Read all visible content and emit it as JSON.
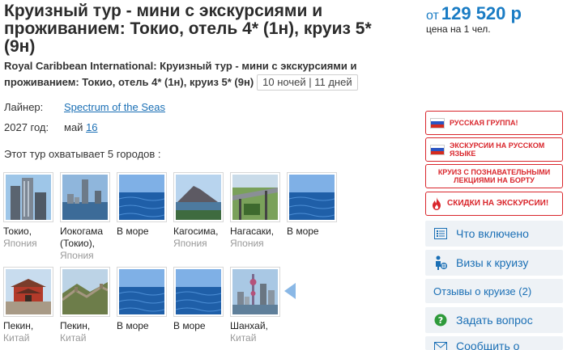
{
  "tour": {
    "title": "Круизный тур - мини с экскурсиями и проживанием: Токио, отель 4* (1н), круиз 5* (9н)",
    "subtitle": "Royal Caribbean International: Круизный тур - мини с экскурсиями и проживанием: Токио, отель 4* (1н), круиз 5* (9н)",
    "duration": "10 ночей | 11 дней"
  },
  "price": {
    "prefix": "от",
    "amount": "129 520 р",
    "note": "цена на 1 чел."
  },
  "liner": {
    "label": "Лайнер:",
    "value": "Spectrum of the Seas"
  },
  "year": {
    "label": "2027 год:",
    "month": "май",
    "day": "16"
  },
  "coverage_text": "Этот тур охватывает 5 городов :",
  "cities": [
    {
      "name": "Токио,",
      "country": "Япония"
    },
    {
      "name": "Иокогама (Токио),",
      "country": "Япония"
    },
    {
      "name": "В море",
      "country": ""
    },
    {
      "name": "Кагосима,",
      "country": "Япония"
    },
    {
      "name": "Нагасаки,",
      "country": "Япония"
    },
    {
      "name": "В море",
      "country": ""
    },
    {
      "name": "Пекин,",
      "country": "Китай"
    },
    {
      "name": "Пекин,",
      "country": "Китай"
    },
    {
      "name": "В море",
      "country": ""
    },
    {
      "name": "В море",
      "country": ""
    },
    {
      "name": "Шанхай,",
      "country": "Китай"
    }
  ],
  "badges": {
    "russian_group": "Русская группа!",
    "excursions_russian": "Экскурсии на русском языке",
    "lectures": "Круиз с познавательными лекциями на борту",
    "discounts": "Скидки на экскурсии!"
  },
  "menu": {
    "included": "Что включено",
    "visas": "Визы к круизу",
    "reviews": "Отзывы о круизе (2)",
    "ask": "Задать вопрос",
    "report": "Сообщить о"
  },
  "colors": {
    "accent": "#1a7cc4",
    "badge_red": "#d9262c",
    "menu_bg": "#eef2f6"
  }
}
